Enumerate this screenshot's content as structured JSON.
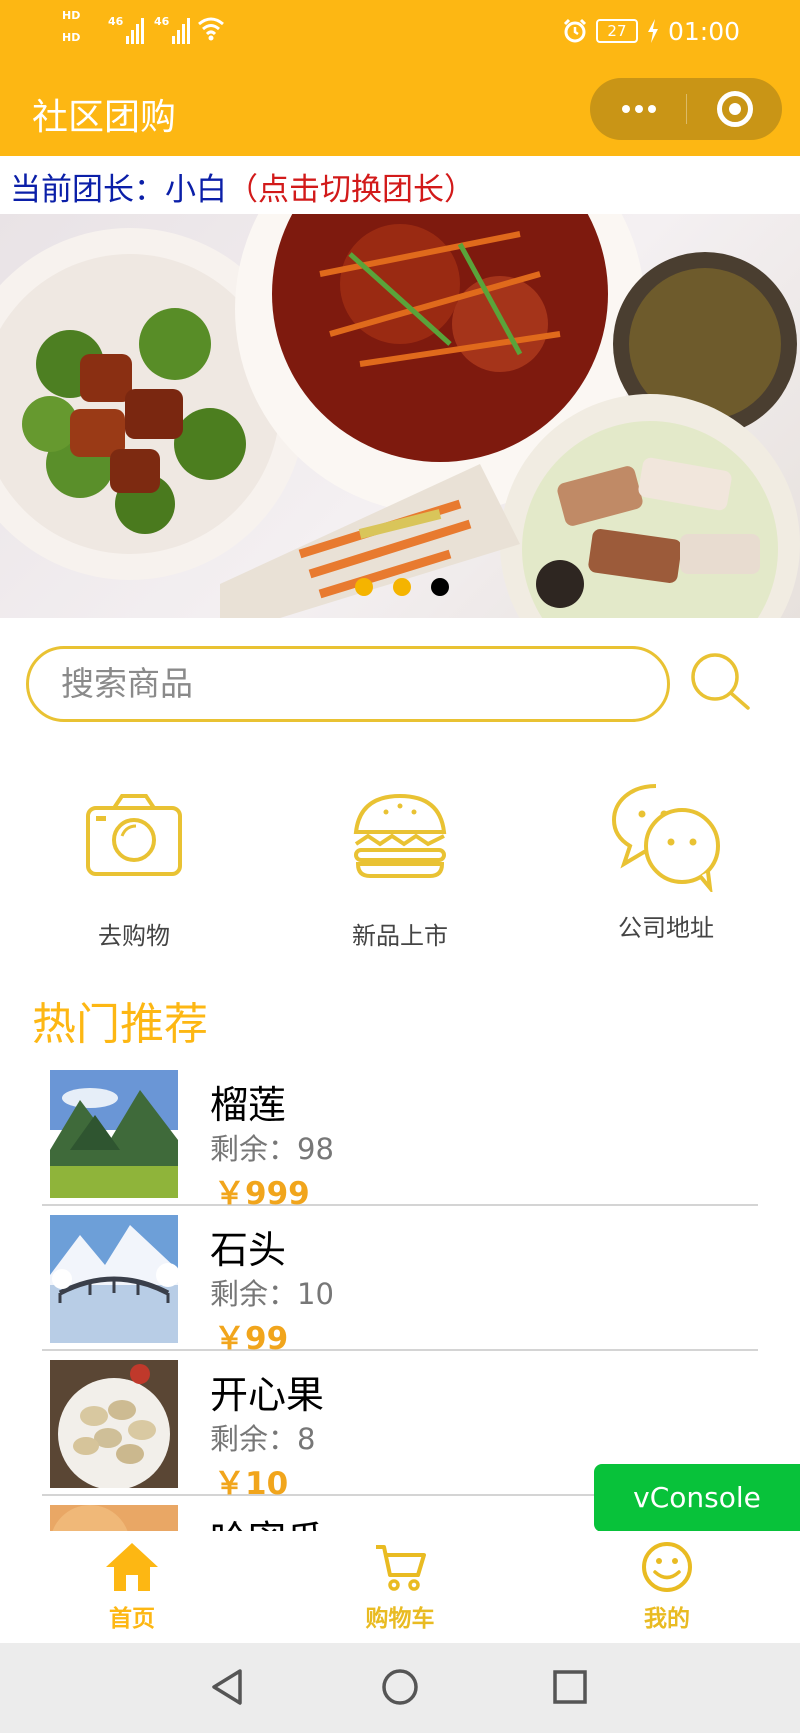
{
  "status_bar": {
    "network_1": "HD",
    "network_2": "HD",
    "sim1": "46",
    "sim2": "46",
    "battery": "27",
    "time": "01:00"
  },
  "header": {
    "title": "社区团购"
  },
  "leader": {
    "key": "当前团长：",
    "name": "小白",
    "switch": "（点击切换团长）"
  },
  "banner": {
    "slide_count": 3,
    "active_index": 2
  },
  "search": {
    "placeholder": "搜索商品"
  },
  "categories": [
    {
      "label": "去购物",
      "icon": "camera-icon"
    },
    {
      "label": "新品上市",
      "icon": "burger-icon"
    },
    {
      "label": "公司地址",
      "icon": "chat-icon"
    }
  ],
  "section_title": "热门推荐",
  "products": [
    {
      "name": "榴莲",
      "stock_label": "剩余：",
      "stock": "98",
      "price": "￥999",
      "thumb": "mountain-meadow"
    },
    {
      "name": "石头",
      "stock_label": "剩余：",
      "stock": "10",
      "price": "￥99",
      "thumb": "snowy-bridge"
    },
    {
      "name": "开心果",
      "stock_label": "剩余：",
      "stock": "8",
      "price": "￥10",
      "thumb": "pistachios"
    },
    {
      "name": "哈密瓜",
      "thumb": "melon"
    }
  ],
  "vconsole": "vConsole",
  "tabbar": [
    {
      "label": "首页",
      "icon": "home-icon",
      "active": true
    },
    {
      "label": "购物车",
      "icon": "cart-icon",
      "active": false
    },
    {
      "label": "我的",
      "icon": "smiley-icon",
      "active": false
    }
  ],
  "colors": {
    "brand": "#fdb713",
    "price": "#f1a51c",
    "leader_key": "#0b1fa8",
    "leader_switch": "#d21a1a",
    "vconsole": "#08c23a"
  }
}
